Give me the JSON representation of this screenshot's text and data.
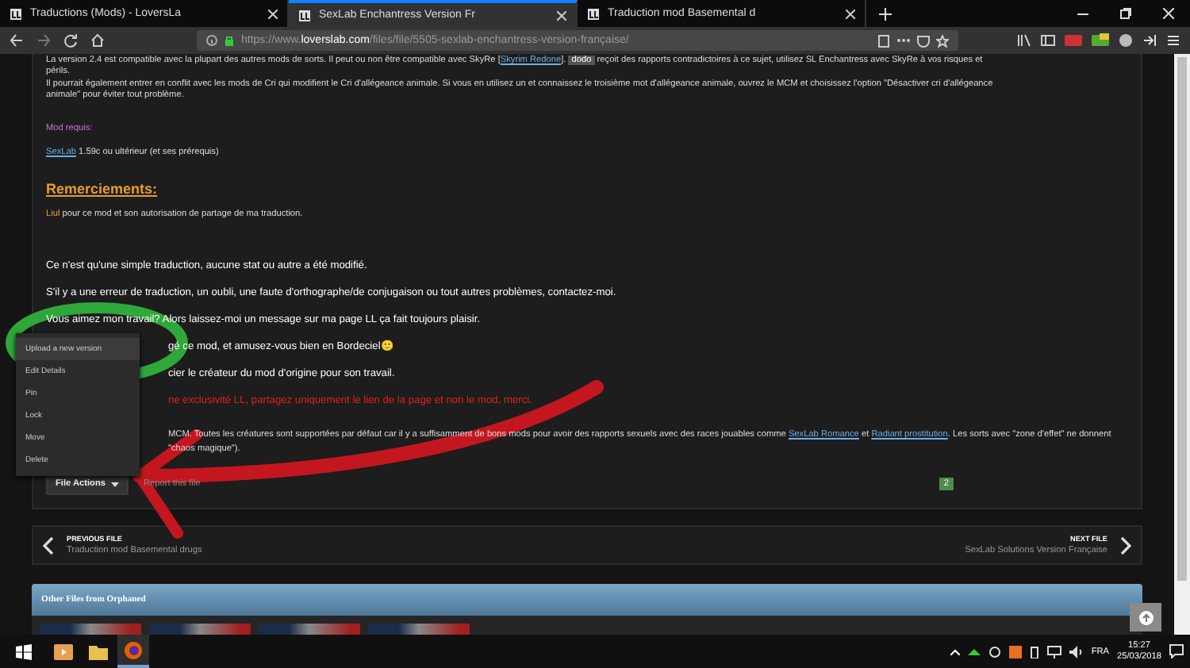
{
  "browser": {
    "tabs": [
      {
        "title": "Traductions (Mods) - LoversLa",
        "selected": false
      },
      {
        "title": "SexLab Enchantress Version Fr",
        "selected": true
      },
      {
        "title": "Traduction mod Basemental d",
        "selected": false
      }
    ],
    "url": {
      "prefix": "https://www.",
      "domain": "loverslab.com",
      "path": "/files/file/5505-sexlab-enchantress-version-française/"
    }
  },
  "post": {
    "paragraphs": [
      {
        "kind": "small",
        "parts": [
          {
            "kind": "plain",
            "text": "La version 2.4 est compatible avec la plupart des autres mods de sorts. Il peut ou non être compatible avec SkyRe ["
          },
          {
            "kind": "link",
            "text": "Skyrim Redone"
          },
          {
            "kind": "plain",
            "text": "]. "
          },
          {
            "kind": "tag",
            "text": "dodo"
          },
          {
            "kind": "plain",
            "text": " reçoit des rapports contradictoires à ce sujet, utilisez SL Enchantress avec SkyRe à vos risques et périls."
          }
        ]
      },
      {
        "kind": "small",
        "parts": [
          {
            "kind": "plain",
            "text": "Il pourrait également entrer en conflit avec les mods de Cri qui modifient le Cri d'allégeance animale. Si vous en utilisez un et connaissez le troisième mot d'allégeance animale, ouvrez le MCM et choisissez l'option \"Désactiver cri d'allégeance animale\" pour éviter tout problème."
          }
        ]
      },
      {
        "kind": "label",
        "parts": [
          {
            "kind": "plain",
            "text": "Mod requis:"
          }
        ]
      },
      {
        "kind": "small",
        "parts": [
          {
            "kind": "link",
            "text": "SexLab"
          },
          {
            "kind": "plain",
            "text": " 1.59c ou ultérieur (et ses prérequis)"
          }
        ]
      },
      {
        "kind": "heading",
        "parts": [
          {
            "kind": "plain",
            "text": "Remerciements:"
          }
        ]
      },
      {
        "kind": "small",
        "parts": [
          {
            "kind": "name",
            "text": "Liul"
          },
          {
            "kind": "plain",
            "text": " pour ce mod et son autorisation de partage de ma traduction."
          }
        ]
      },
      {
        "kind": "normal",
        "parts": [
          {
            "kind": "plain",
            "text": "Ce n'est qu'une simple traduction, aucune stat ou autre a été modifié."
          }
        ]
      },
      {
        "kind": "normal",
        "parts": [
          {
            "kind": "plain",
            "text": "S'il y a une erreur de traduction, un oubli, une faute d'orthographe/de conjugaison ou tout autres problèmes, contactez-moi."
          }
        ]
      },
      {
        "kind": "normal",
        "parts": [
          {
            "kind": "plain",
            "text": "Vous aimez mon travail? Alors laissez-moi un message sur ma page LL ça fait toujours plaisir."
          }
        ]
      },
      {
        "kind": "normal-indent",
        "parts": [
          {
            "kind": "plain",
            "text": "gé ce mod, et amusez-vous bien en Bordeciel"
          },
          {
            "kind": "emoji",
            "text": "🙂"
          }
        ]
      },
      {
        "kind": "normal-indent",
        "parts": [
          {
            "kind": "plain",
            "text": "cier le créateur du mod d'origine pour son travail."
          }
        ]
      },
      {
        "kind": "warning-indent",
        "parts": [
          {
            "kind": "plain",
            "text": "ne exclusivité LL, partagez uniquement le lien de la page et non le mod, merci."
          }
        ]
      },
      {
        "kind": "small-indent",
        "parts": [
          {
            "kind": "plain",
            "text": "MCM. Toutes les créatures sont supportées par défaut car il y a suffisamment de bons mods pour avoir des rapports sexuels avec des races jouables comme "
          },
          {
            "kind": "link",
            "text": "SexLab Romance"
          },
          {
            "kind": "plain",
            "text": " et "
          },
          {
            "kind": "link",
            "text": "Radiant prostitution"
          },
          {
            "kind": "plain",
            "text": ". Les sorts avec \"zone d'effet\" ne donnent"
          }
        ]
      },
      {
        "kind": "small-indent",
        "parts": [
          {
            "kind": "plain",
            "text": "\"chaos magique\")."
          }
        ]
      }
    ],
    "file_actions": "File Actions",
    "report": "Report this file",
    "count": "2"
  },
  "menu": {
    "items": [
      {
        "label": "Upload a new version",
        "selected": true
      },
      {
        "label": "Edit Details",
        "selected": false
      },
      {
        "label": "Pin",
        "selected": false
      },
      {
        "label": "Lock",
        "selected": false
      },
      {
        "label": "Move",
        "selected": false
      },
      {
        "label": "Delete",
        "selected": false
      }
    ]
  },
  "file_nav": {
    "previous": {
      "label": "PREVIOUS FILE",
      "title": "Traduction mod Basemental drugs"
    },
    "next": {
      "label": "NEXT FILE",
      "title": "SexLab Solutions Version Française"
    }
  },
  "other_files": {
    "title": "Other Files from Orphaned",
    "thumbnails": [
      {
        "kind": "photo"
      },
      {
        "kind": "photo"
      },
      {
        "kind": "photo"
      },
      {
        "kind": "photo"
      }
    ]
  },
  "annotations": [
    {
      "kind": "green-circle"
    },
    {
      "kind": "red-arrow"
    }
  ],
  "taskbar": {
    "apps": [
      {
        "kind": "media",
        "selected": false
      },
      {
        "kind": "folder",
        "selected": false
      },
      {
        "kind": "browser",
        "selected": true
      }
    ],
    "language": "FRA",
    "time": "15:27",
    "date": "25/03/2018"
  }
}
